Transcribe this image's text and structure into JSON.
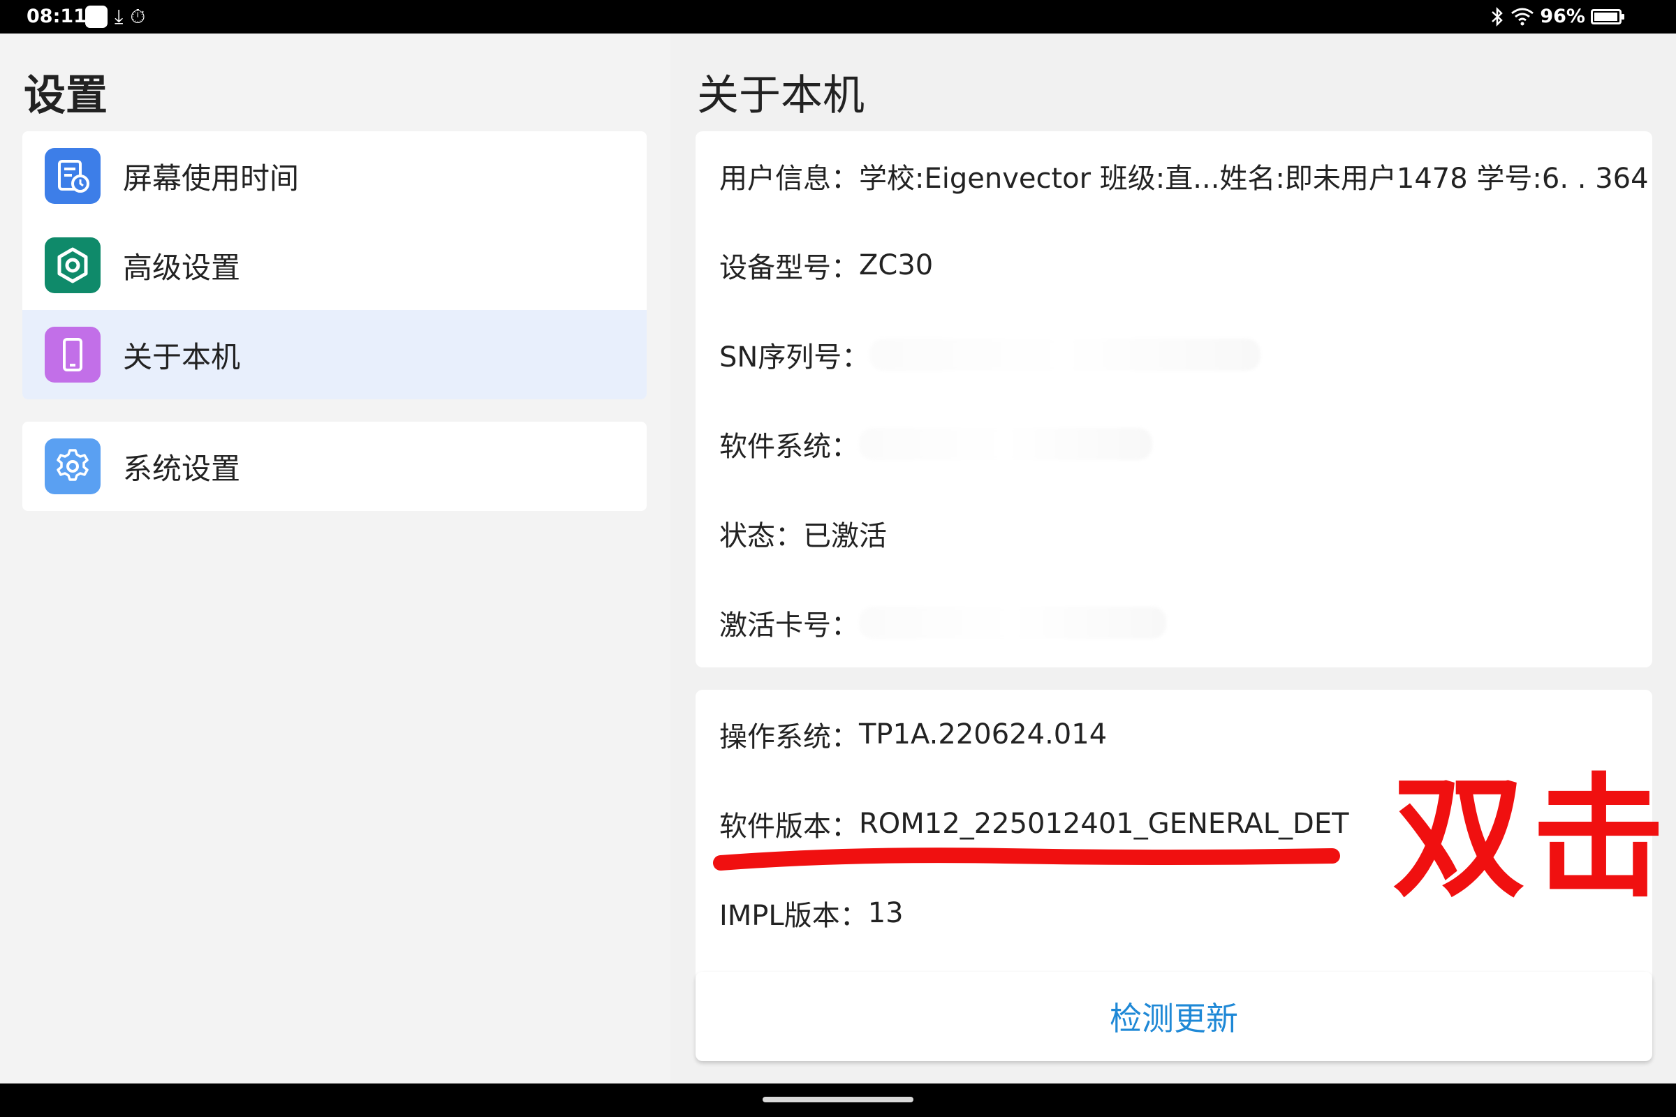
{
  "status_bar": {
    "time": "08:11",
    "battery": "96%",
    "battery_level": 0.96,
    "icons": [
      "notification-icon",
      "download-icon",
      "timer-icon",
      "bluetooth-icon",
      "wifi-icon",
      "battery-icon"
    ]
  },
  "left_pane": {
    "title": "设置",
    "items": [
      {
        "label": "屏幕使用时间",
        "icon": "screen-time-icon",
        "color": "#3d7ee8",
        "selected": false
      },
      {
        "label": "高级设置",
        "icon": "gear-icon",
        "color": "#0f8a6a",
        "selected": false
      },
      {
        "label": "关于本机",
        "icon": "phone-icon",
        "color": "#c26fe8",
        "selected": true
      },
      {
        "label": "系统设置",
        "icon": "gear-icon",
        "color": "#5aa0f2",
        "selected": false
      }
    ]
  },
  "right_pane": {
    "title": "关于本机",
    "card1": [
      {
        "label": "用户信息：",
        "value": "学校:Eigenvector 班级:直...姓名:即未用户1478 学号:6. . 364"
      },
      {
        "label": "设备型号：",
        "value": "ZC30"
      },
      {
        "label": "SN序列号：",
        "value": ""
      },
      {
        "label": "软件系统：",
        "value": ""
      },
      {
        "label": "状态：",
        "value": "已激活"
      },
      {
        "label": "激活卡号：",
        "value": ""
      }
    ],
    "card2": [
      {
        "label": "操作系统：",
        "value": "TP1A.220624.014"
      },
      {
        "label": "软件版本：",
        "value": "ROM12_225012401_GENERAL_DET"
      },
      {
        "label": "IMPL版本：",
        "value": "13"
      }
    ],
    "update_button": "检测更新"
  },
  "annotation": {
    "text": "双击",
    "color": "#f01010"
  },
  "colors": {
    "accent": "#1e88d6",
    "selected_bg": "#e8effc"
  }
}
